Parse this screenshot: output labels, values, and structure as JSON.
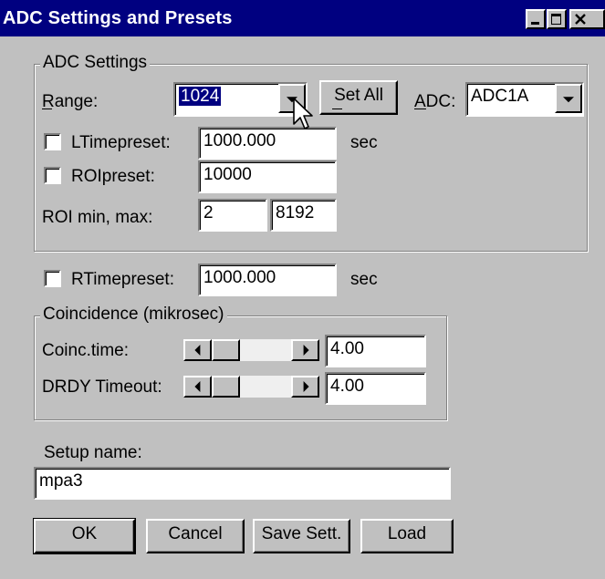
{
  "window": {
    "title": "ADC Settings and Presets"
  },
  "adc_settings": {
    "legend": "ADC Settings",
    "range_label": "Range:",
    "range_value": "1024",
    "set_all_label": "Set All",
    "adc_label": "ADC:",
    "adc_value": "ADC1A",
    "ltime_label": "LTimepreset:",
    "ltime_value": "1000.000",
    "ltime_unit": "sec",
    "roi_label": "ROIpreset:",
    "roi_value": "10000",
    "roi_minmax_label": "ROI min, max:",
    "roi_min": "2",
    "roi_max": "8192"
  },
  "rtime": {
    "label": "RTimepreset:",
    "value": "1000.000",
    "unit": "sec"
  },
  "coincidence": {
    "legend": "Coincidence (mikrosec)",
    "coinc_label": "Coinc.time:",
    "coinc_value": "4.00",
    "drdy_label": "DRDY Timeout:",
    "drdy_value": "4.00"
  },
  "setup": {
    "label": "Setup name:",
    "value": "mpa3"
  },
  "buttons": {
    "ok": "OK",
    "cancel": "Cancel",
    "save": "Save Sett.",
    "load": "Load"
  },
  "icons": [
    "minimize-icon",
    "maximize-icon",
    "close-icon",
    "dropdown-arrow-icon",
    "scroll-left-icon",
    "scroll-right-icon",
    "mouse-cursor-icon"
  ]
}
